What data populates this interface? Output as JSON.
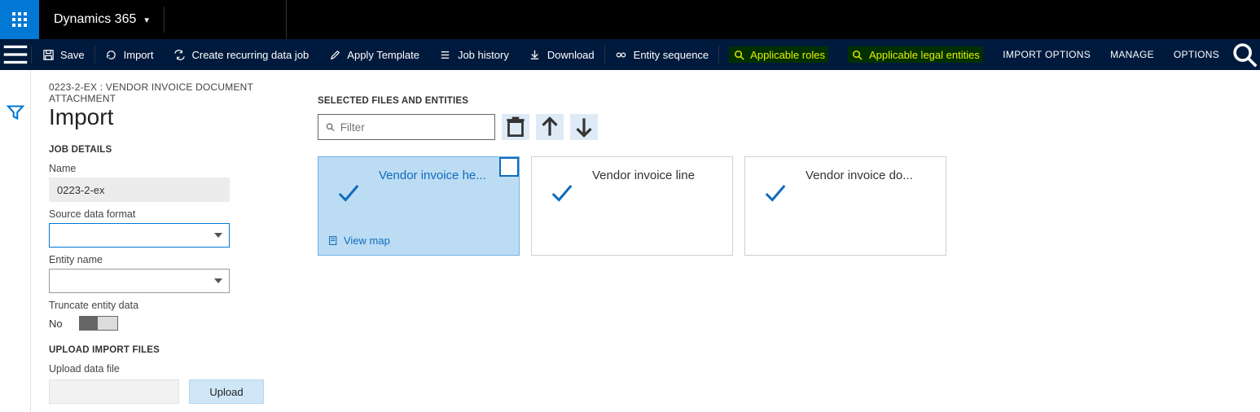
{
  "brand": {
    "name": "Dynamics 365"
  },
  "actionbar": {
    "save": "Save",
    "import": "Import",
    "recurring": "Create recurring data job",
    "apply_template": "Apply Template",
    "job_history": "Job history",
    "download": "Download",
    "entity_sequence": "Entity sequence",
    "applicable_roles": "Applicable roles",
    "applicable_entities": "Applicable legal entities",
    "import_options": "IMPORT OPTIONS",
    "manage": "MANAGE",
    "options": "OPTIONS"
  },
  "page": {
    "breadcrumb": "0223-2-EX : VENDOR INVOICE DOCUMENT ATTACHMENT",
    "title": "Import"
  },
  "job_details": {
    "heading": "JOB DETAILS",
    "name_label": "Name",
    "name_value": "0223-2-ex",
    "source_format_label": "Source data format",
    "source_format_value": "",
    "entity_name_label": "Entity name",
    "entity_name_value": "",
    "truncate_label": "Truncate entity data",
    "truncate_value": "No"
  },
  "upload": {
    "heading": "UPLOAD IMPORT FILES",
    "label": "Upload data file",
    "button": "Upload"
  },
  "selected": {
    "heading": "SELECTED FILES AND ENTITIES",
    "filter_placeholder": "Filter",
    "cards": [
      {
        "title": "Vendor invoice he...",
        "view_map": "View map",
        "active": true
      },
      {
        "title": "Vendor invoice line",
        "active": false
      },
      {
        "title": "Vendor invoice do...",
        "active": false
      }
    ]
  }
}
